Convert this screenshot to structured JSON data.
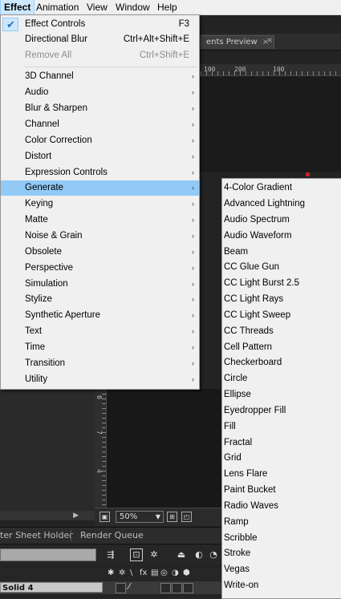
{
  "menubar": {
    "items": [
      {
        "label": "Effect",
        "active": true
      },
      {
        "label": "Animation"
      },
      {
        "label": "View"
      },
      {
        "label": "Window"
      },
      {
        "label": "Help"
      }
    ]
  },
  "effect_menu": {
    "top_items": [
      {
        "label": "Effect Controls",
        "shortcut": "F3",
        "checked": true
      },
      {
        "label": "Directional Blur",
        "shortcut": "Ctrl+Alt+Shift+E"
      },
      {
        "label": "Remove All",
        "shortcut": "Ctrl+Shift+E",
        "disabled": true
      }
    ],
    "categories": [
      "3D Channel",
      "Audio",
      "Blur & Sharpen",
      "Channel",
      "Color Correction",
      "Distort",
      "Expression Controls",
      "Generate",
      "Keying",
      "Matte",
      "Noise & Grain",
      "Obsolete",
      "Perspective",
      "Simulation",
      "Stylize",
      "Synthetic Aperture",
      "Text",
      "Time",
      "Transition",
      "Utility"
    ],
    "highlighted": "Generate"
  },
  "generate_submenu": {
    "items": [
      "4-Color Gradient",
      "Advanced Lightning",
      "Audio Spectrum",
      "Audio Waveform",
      "Beam",
      "CC Glue Gun",
      "CC Light Burst 2.5",
      "CC Light Rays",
      "CC Light Sweep",
      "CC Threads",
      "Cell Pattern",
      "Checkerboard",
      "Circle",
      "Ellipse",
      "Eyedropper Fill",
      "Fill",
      "Fractal",
      "Grid",
      "Lens Flare",
      "Paint Bucket",
      "Radio Waves",
      "Ramp",
      "Scribble",
      "Stroke",
      "Vegas",
      "Write-on"
    ]
  },
  "background": {
    "panel_tab": "ents Preview",
    "ruler_ticks": [
      "100",
      "200",
      "100"
    ],
    "zoom": "50%",
    "lower_tabs": [
      "ter Sheet Holder",
      "Render Queue"
    ],
    "layer_name": "Solid 4"
  },
  "colors": {
    "menu_bg": "#f0f0f0",
    "highlight": "#91c9f7",
    "menubar_active": "#cce8ff",
    "app_bg": "#232323"
  }
}
